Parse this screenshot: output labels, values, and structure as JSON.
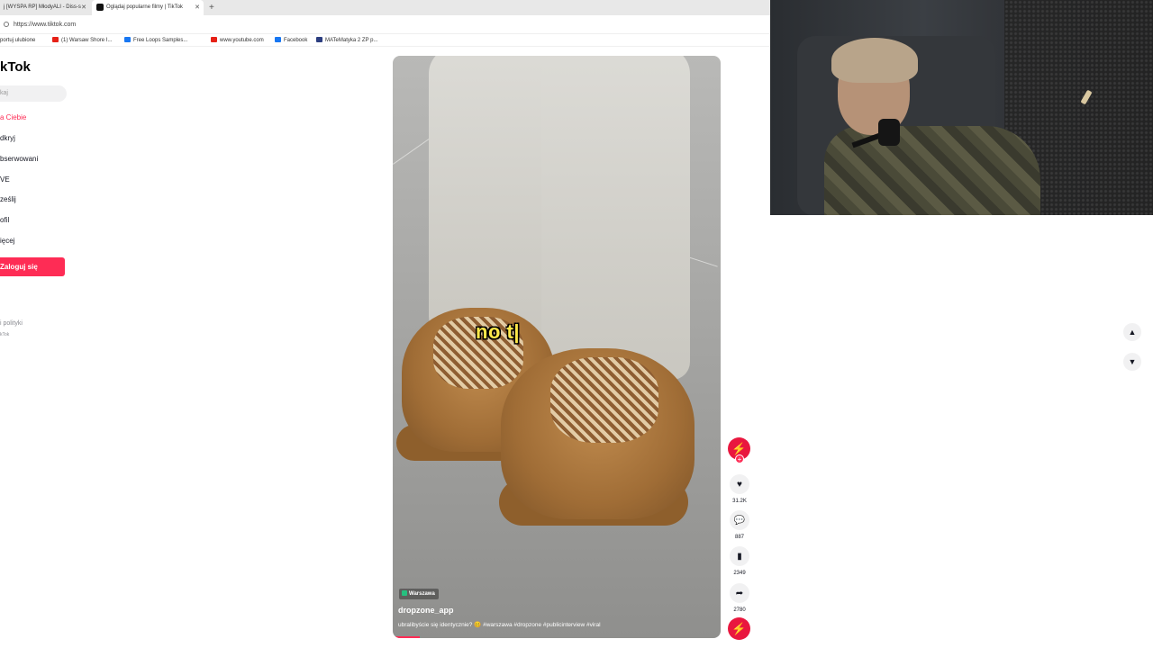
{
  "browser": {
    "tabs": [
      {
        "label": "j [WYSPA RP] MłodyALI - Diss-s"
      },
      {
        "label": "Oglądaj popularne filmy | TikTok"
      }
    ],
    "url": "https://www.tiktok.com",
    "bookmarks": [
      {
        "label": "portuj ulubione"
      },
      {
        "label": "(1) Warsaw Shore I..."
      },
      {
        "label": "Free Loops Samples..."
      },
      {
        "label": "www.youtube.com"
      },
      {
        "label": "Facebook"
      },
      {
        "label": "MATeMatyka 2 ZP p..."
      }
    ]
  },
  "sidebar": {
    "logo": "kTok",
    "search_placeholder": "kaj",
    "items": [
      {
        "label": "a Ciebie"
      },
      {
        "label": "dkryj"
      },
      {
        "label": "bserwowani"
      },
      {
        "label": "VE"
      },
      {
        "label": "ześlij"
      },
      {
        "label": "ofil"
      },
      {
        "label": "ięcej"
      }
    ],
    "login_label": "Zaloguj się",
    "footer_links": "i polityki",
    "footer_copyright": "kTok"
  },
  "video": {
    "overlay_caption": "no t|",
    "location": "Warszawa",
    "author": "dropzone_app",
    "description": "ubralibyście się identycznie? 🥴 #warszawa #dropzone #publicinterview #viral"
  },
  "actions": {
    "likes": "31.2K",
    "comments": "887",
    "saves": "2349",
    "shares": "2780"
  },
  "icons": {
    "like": "heart-icon",
    "comment": "comment-icon",
    "save": "bookmark-icon",
    "share": "share-icon"
  },
  "colors": {
    "brand": "#fe2c55",
    "caption": "#ffe94a"
  }
}
